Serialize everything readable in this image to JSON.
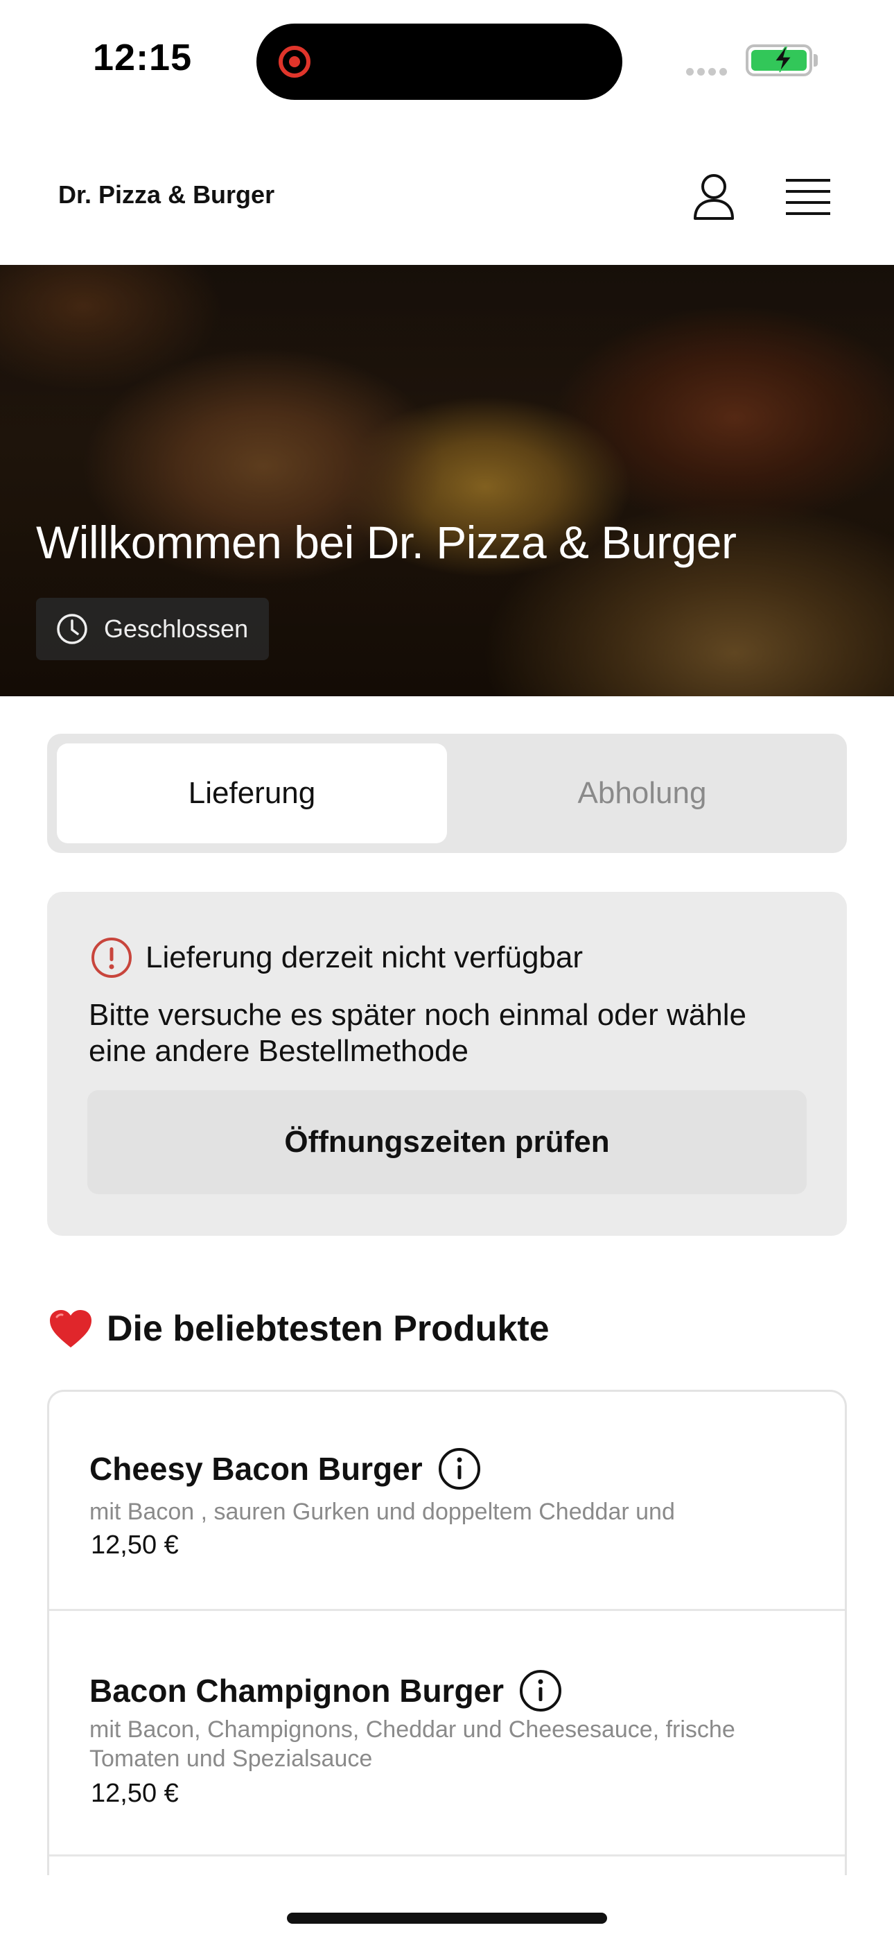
{
  "status_bar": {
    "time": "12:15"
  },
  "header": {
    "brand": "Dr. Pizza & Burger",
    "icons": {
      "account": "user-icon",
      "menu": "hamburger-menu-icon"
    }
  },
  "hero": {
    "title": "Willkommen bei Dr. Pizza & Burger",
    "status": "Geschlossen"
  },
  "order_mode": {
    "options": [
      "Lieferung",
      "Abholung"
    ],
    "selected": "Lieferung"
  },
  "notice": {
    "title": "Lieferung derzeit nicht verfügbar",
    "body": "Bitte versuche es später noch einmal oder wähle eine andere Bestellmethode",
    "button": "Öffnungszeiten prüfen",
    "accent_color": "#c8453c"
  },
  "popular": {
    "title": "Die beliebtesten Produkte",
    "emoji": "❤️",
    "products": [
      {
        "name": "Cheesy Bacon Burger",
        "description": "mit Bacon , sauren Gurken und doppeltem Cheddar und",
        "price": "12,50 €"
      },
      {
        "name": "Bacon Champignon Burger",
        "description": "mit Bacon, Champignons, Cheddar und Cheesesauce, frische Tomaten und Spezialsauce",
        "price": "12,50 €"
      }
    ]
  },
  "colors": {
    "battery": "#32c759",
    "recording": "#e0352b",
    "heart": "#e0262b"
  }
}
